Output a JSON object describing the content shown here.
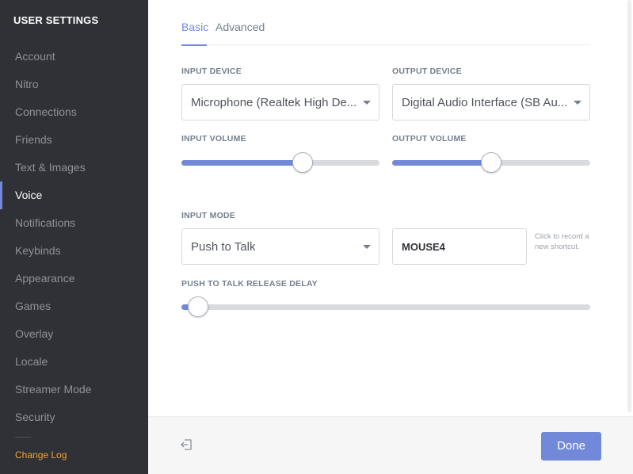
{
  "sidebar": {
    "title": "USER SETTINGS",
    "items": [
      {
        "label": "Account"
      },
      {
        "label": "Nitro"
      },
      {
        "label": "Connections"
      },
      {
        "label": "Friends"
      },
      {
        "label": "Text & Images"
      },
      {
        "label": "Voice"
      },
      {
        "label": "Notifications"
      },
      {
        "label": "Keybinds"
      },
      {
        "label": "Appearance"
      },
      {
        "label": "Games"
      },
      {
        "label": "Overlay"
      },
      {
        "label": "Locale"
      },
      {
        "label": "Streamer Mode"
      },
      {
        "label": "Security"
      }
    ],
    "active_item": "Voice",
    "changelog": "Change Log"
  },
  "tabs": {
    "basic": "Basic",
    "advanced": "Advanced",
    "active": "Basic"
  },
  "voice": {
    "input_device_label": "INPUT DEVICE",
    "input_device_value": "Microphone (Realtek High De...",
    "output_device_label": "OUTPUT DEVICE",
    "output_device_value": "Digital Audio Interface (SB Au...",
    "input_volume_label": "INPUT VOLUME",
    "input_volume_level": 0.61,
    "output_volume_label": "OUTPUT VOLUME",
    "output_volume_level": 0.5,
    "input_mode_label": "INPUT MODE",
    "input_mode_value": "Push to Talk",
    "keybind_value": "MOUSE4",
    "keybind_hint": "Click to record a new shortcut.",
    "ptt_delay_label": "PUSH TO TALK RELEASE DELAY",
    "ptt_delay_level": 0.04
  },
  "footer": {
    "done_label": "Done"
  },
  "colors": {
    "accent": "#7289da",
    "sidebar_bg": "#2f3136",
    "changelog": "#f0a532"
  },
  "icons": {
    "exit": "exit-icon",
    "caret": "chevron-down-icon"
  }
}
